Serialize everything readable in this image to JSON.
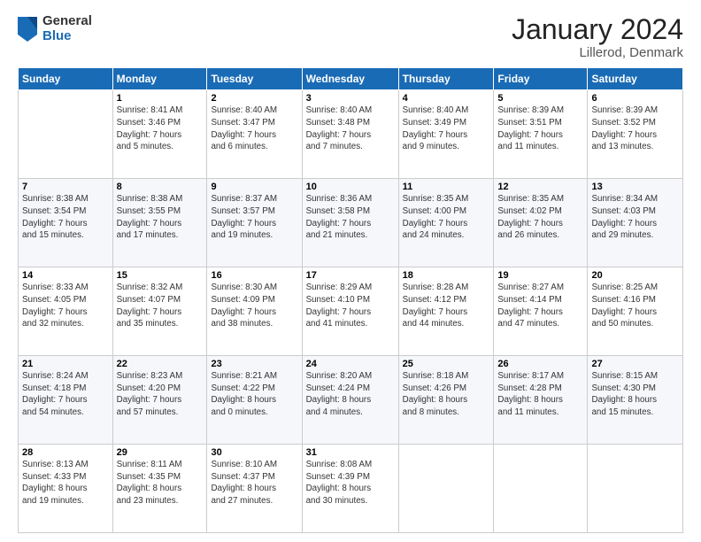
{
  "header": {
    "logo_general": "General",
    "logo_blue": "Blue",
    "title": "January 2024",
    "location": "Lillerod, Denmark"
  },
  "days_header": [
    "Sunday",
    "Monday",
    "Tuesday",
    "Wednesday",
    "Thursday",
    "Friday",
    "Saturday"
  ],
  "weeks": [
    [
      {
        "day": "",
        "info": ""
      },
      {
        "day": "1",
        "info": "Sunrise: 8:41 AM\nSunset: 3:46 PM\nDaylight: 7 hours\nand 5 minutes."
      },
      {
        "day": "2",
        "info": "Sunrise: 8:40 AM\nSunset: 3:47 PM\nDaylight: 7 hours\nand 6 minutes."
      },
      {
        "day": "3",
        "info": "Sunrise: 8:40 AM\nSunset: 3:48 PM\nDaylight: 7 hours\nand 7 minutes."
      },
      {
        "day": "4",
        "info": "Sunrise: 8:40 AM\nSunset: 3:49 PM\nDaylight: 7 hours\nand 9 minutes."
      },
      {
        "day": "5",
        "info": "Sunrise: 8:39 AM\nSunset: 3:51 PM\nDaylight: 7 hours\nand 11 minutes."
      },
      {
        "day": "6",
        "info": "Sunrise: 8:39 AM\nSunset: 3:52 PM\nDaylight: 7 hours\nand 13 minutes."
      }
    ],
    [
      {
        "day": "7",
        "info": ""
      },
      {
        "day": "8",
        "info": "Sunrise: 8:38 AM\nSunset: 3:55 PM\nDaylight: 7 hours\nand 17 minutes."
      },
      {
        "day": "9",
        "info": "Sunrise: 8:37 AM\nSunset: 3:57 PM\nDaylight: 7 hours\nand 19 minutes."
      },
      {
        "day": "10",
        "info": "Sunrise: 8:36 AM\nSunset: 3:58 PM\nDaylight: 7 hours\nand 21 minutes."
      },
      {
        "day": "11",
        "info": "Sunrise: 8:35 AM\nSunset: 4:00 PM\nDaylight: 7 hours\nand 24 minutes."
      },
      {
        "day": "12",
        "info": "Sunrise: 8:35 AM\nSunset: 4:02 PM\nDaylight: 7 hours\nand 26 minutes."
      },
      {
        "day": "13",
        "info": "Sunrise: 8:34 AM\nSunset: 4:03 PM\nDaylight: 7 hours\nand 29 minutes."
      }
    ],
    [
      {
        "day": "14",
        "info": ""
      },
      {
        "day": "15",
        "info": "Sunrise: 8:32 AM\nSunset: 4:07 PM\nDaylight: 7 hours\nand 35 minutes."
      },
      {
        "day": "16",
        "info": "Sunrise: 8:30 AM\nSunset: 4:09 PM\nDaylight: 7 hours\nand 38 minutes."
      },
      {
        "day": "17",
        "info": "Sunrise: 8:29 AM\nSunset: 4:10 PM\nDaylight: 7 hours\nand 41 minutes."
      },
      {
        "day": "18",
        "info": "Sunrise: 8:28 AM\nSunset: 4:12 PM\nDaylight: 7 hours\nand 44 minutes."
      },
      {
        "day": "19",
        "info": "Sunrise: 8:27 AM\nSunset: 4:14 PM\nDaylight: 7 hours\nand 47 minutes."
      },
      {
        "day": "20",
        "info": "Sunrise: 8:25 AM\nSunset: 4:16 PM\nDaylight: 7 hours\nand 50 minutes."
      }
    ],
    [
      {
        "day": "21",
        "info": ""
      },
      {
        "day": "22",
        "info": "Sunrise: 8:23 AM\nSunset: 4:20 PM\nDaylight: 7 hours\nand 57 minutes."
      },
      {
        "day": "23",
        "info": "Sunrise: 8:21 AM\nSunset: 4:22 PM\nDaylight: 8 hours\nand 0 minutes."
      },
      {
        "day": "24",
        "info": "Sunrise: 8:20 AM\nSunset: 4:24 PM\nDaylight: 8 hours\nand 4 minutes."
      },
      {
        "day": "25",
        "info": "Sunrise: 8:18 AM\nSunset: 4:26 PM\nDaylight: 8 hours\nand 8 minutes."
      },
      {
        "day": "26",
        "info": "Sunrise: 8:17 AM\nSunset: 4:28 PM\nDaylight: 8 hours\nand 11 minutes."
      },
      {
        "day": "27",
        "info": "Sunrise: 8:15 AM\nSunset: 4:30 PM\nDaylight: 8 hours\nand 15 minutes."
      }
    ],
    [
      {
        "day": "28",
        "info": ""
      },
      {
        "day": "29",
        "info": "Sunrise: 8:11 AM\nSunset: 4:35 PM\nDaylight: 8 hours\nand 23 minutes."
      },
      {
        "day": "30",
        "info": "Sunrise: 8:10 AM\nSunset: 4:37 PM\nDaylight: 8 hours\nand 27 minutes."
      },
      {
        "day": "31",
        "info": "Sunrise: 8:08 AM\nSunset: 4:39 PM\nDaylight: 8 hours\nand 30 minutes."
      },
      {
        "day": "",
        "info": ""
      },
      {
        "day": "",
        "info": ""
      },
      {
        "day": "",
        "info": ""
      }
    ]
  ],
  "week_sunday_info": [
    "Sunrise: 8:38 AM\nSunset: 3:54 PM\nDaylight: 7 hours\nand 15 minutes.",
    "Sunrise: 8:33 AM\nSunset: 4:05 PM\nDaylight: 7 hours\nand 32 minutes.",
    "Sunrise: 8:24 AM\nSunset: 4:18 PM\nDaylight: 7 hours\nand 54 minutes.",
    "Sunrise: 8:13 AM\nSunset: 4:33 PM\nDaylight: 8 hours\nand 19 minutes."
  ]
}
